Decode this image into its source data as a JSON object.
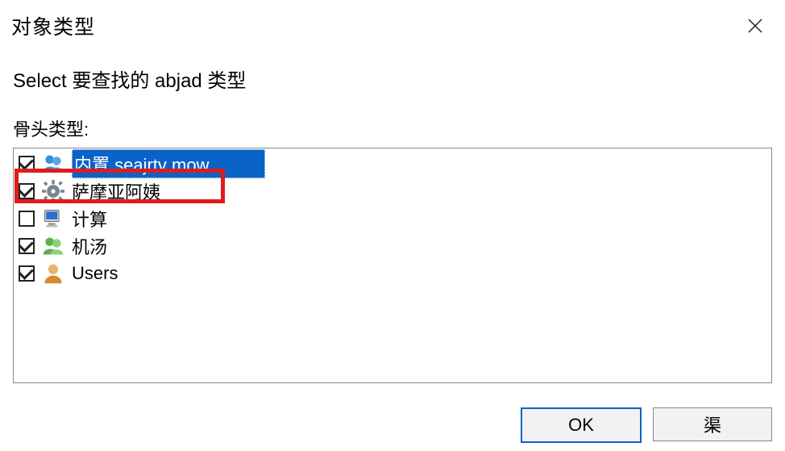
{
  "dialog": {
    "title": "对象类型",
    "instruction": "Select 要查找的 abjad 类型",
    "list_label": "骨头类型:",
    "items": [
      {
        "label": "内置 seajrtv mow",
        "checked": true,
        "icon": "group-icon",
        "selected": true
      },
      {
        "label": "萨摩亚阿姨",
        "checked": true,
        "icon": "gear-icon",
        "selected": false
      },
      {
        "label": "计算",
        "checked": false,
        "icon": "computer-icon",
        "selected": false
      },
      {
        "label": "机汤",
        "checked": true,
        "icon": "group-icon",
        "selected": false
      },
      {
        "label": "Users",
        "checked": true,
        "icon": "user-icon",
        "selected": false
      }
    ],
    "highlight_index": 1,
    "buttons": {
      "ok": "OK",
      "cancel": "渠"
    }
  }
}
